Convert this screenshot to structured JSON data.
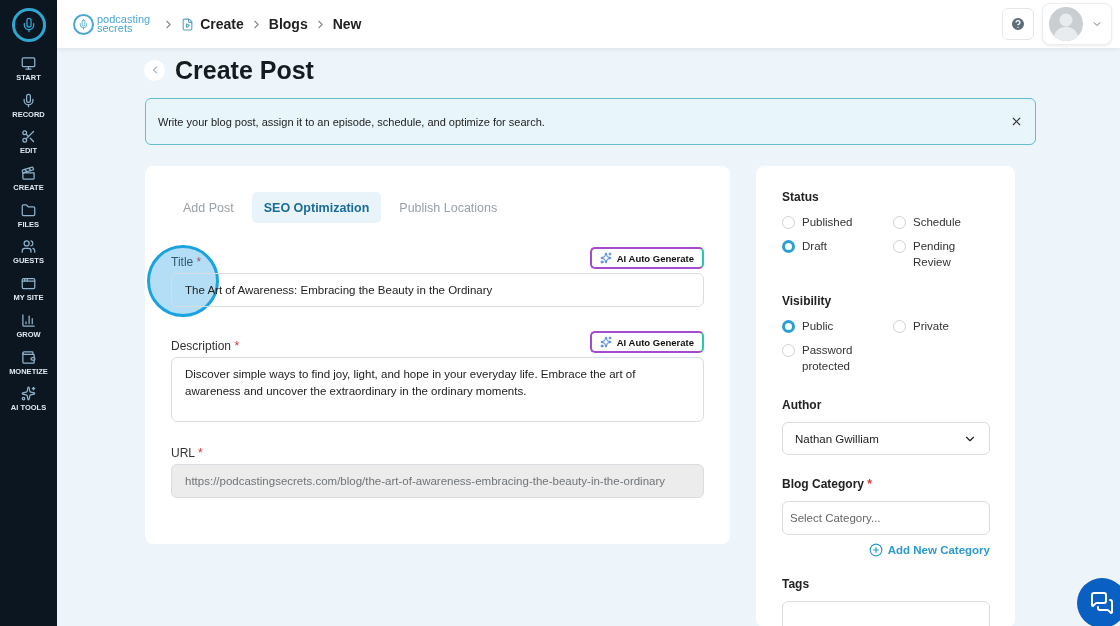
{
  "sidebar": {
    "items": [
      {
        "label": "START"
      },
      {
        "label": "RECORD"
      },
      {
        "label": "EDIT"
      },
      {
        "label": "CREATE"
      },
      {
        "label": "FILES"
      },
      {
        "label": "GUESTS"
      },
      {
        "label": "MY SITE"
      },
      {
        "label": "GROW"
      },
      {
        "label": "MONETIZE"
      },
      {
        "label": "AI TOOLS"
      }
    ]
  },
  "topbar": {
    "brand": [
      "podcasting",
      "secrets"
    ],
    "breadcrumb": [
      "Create",
      "Blogs",
      "New"
    ]
  },
  "page": {
    "title": "Create Post",
    "banner": "Write your blog post, assign it to an episode, schedule, and optimize for search."
  },
  "tabs": [
    {
      "label": "Add Post",
      "selected": false
    },
    {
      "label": "SEO Optimization",
      "selected": true
    },
    {
      "label": "Publish Locations",
      "selected": false
    }
  ],
  "form": {
    "title": {
      "label": "Title",
      "required_mark": "*",
      "generate_label": "AI Auto Generate",
      "value": "The Art of Awareness: Embracing the Beauty in the Ordinary"
    },
    "description": {
      "label": "Description",
      "required_mark": "*",
      "generate_label": "AI Auto Generate",
      "value": "Discover simple ways to find joy, light, and hope in your everyday life. Embrace the art of awareness and uncover the extraordinary in the ordinary moments."
    },
    "url": {
      "label": "URL",
      "required_mark": "*",
      "value": "https://podcastingsecrets.com/blog/the-art-of-awareness-embracing-the-beauty-in-the-ordinary",
      "disabled": true
    }
  },
  "status": {
    "label": "Status",
    "options": [
      {
        "label": "Published",
        "selected": false
      },
      {
        "label": "Schedule",
        "selected": false
      },
      {
        "label": "Draft",
        "selected": true
      },
      {
        "label": "Pending Review",
        "selected": false
      }
    ]
  },
  "visibility": {
    "label": "Visibility",
    "options": [
      {
        "label": "Public",
        "selected": true
      },
      {
        "label": "Private",
        "selected": false
      },
      {
        "label": "Password protected",
        "selected": false
      }
    ]
  },
  "author": {
    "label": "Author",
    "value": "Nathan Gwilliam"
  },
  "category": {
    "label": "Blog Category",
    "required_mark": "*",
    "placeholder": "Select Category...",
    "add_label": "Add New Category"
  },
  "tags": {
    "label": "Tags"
  }
}
